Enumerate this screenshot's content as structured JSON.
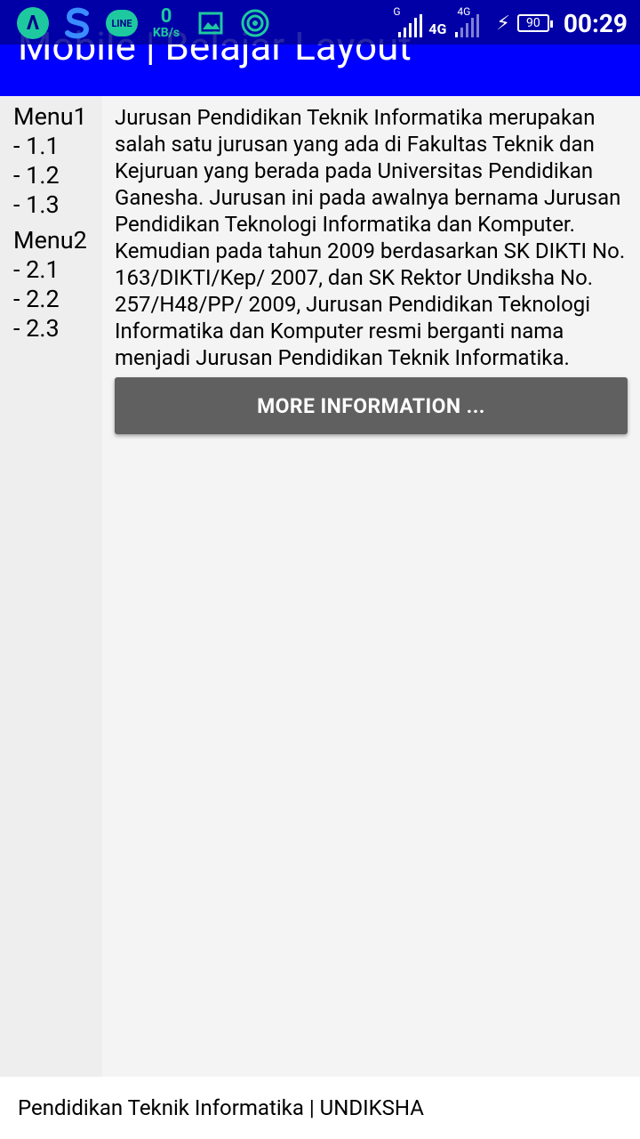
{
  "status_bar": {
    "net_speed_value": "0",
    "net_speed_unit": "KB/s",
    "sim1_type": "G",
    "sim1_network": "4G",
    "sim2_type": "4G",
    "battery_level": "90",
    "time": "00:29",
    "line_app_label": "LINE"
  },
  "app_bar": {
    "title": "Mobile | Belajar Layout",
    "color": "#0000ff"
  },
  "sidebar": {
    "groups": [
      {
        "label": "Menu1",
        "items": [
          "- 1.1",
          "- 1.2",
          "- 1.3"
        ]
      },
      {
        "label": "Menu2",
        "items": [
          "- 2.1",
          "- 2.2",
          "- 2.3"
        ]
      }
    ]
  },
  "main": {
    "description": "Jurusan Pendidikan Teknik Informatika merupakan salah satu jurusan yang ada di Fakultas Teknik dan Kejuruan yang berada pada Universitas Pendidikan Ganesha. Jurusan ini pada awalnya bernama Jurusan Pendidikan Teknologi Informatika dan Komputer. Kemudian pada tahun 2009 berdasarkan SK DIKTI No. 163/DIKTI/Kep/ 2007, dan SK Rektor Undiksha No. 257/H48/PP/ 2009, Jurusan Pendidikan Teknologi Informatika dan Komputer resmi berganti nama menjadi Jurusan Pendidikan Teknik Informatika.",
    "more_button_label": "MORE INFORMATION ..."
  },
  "footer": {
    "text": "Pendidikan Teknik Informatika | UNDIKSHA"
  }
}
